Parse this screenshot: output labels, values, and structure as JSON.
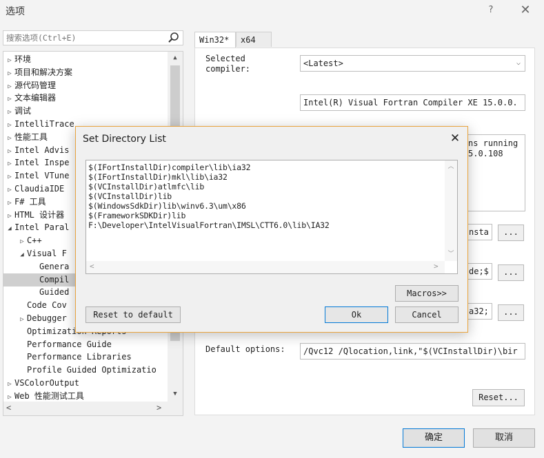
{
  "window": {
    "title": "选项",
    "help": "?",
    "close": "✕"
  },
  "search": {
    "placeholder": "搜索选项(Ctrl+E)"
  },
  "tree": {
    "items": [
      {
        "arrow": "▷",
        "label": "环境",
        "indent": 0
      },
      {
        "arrow": "▷",
        "label": "项目和解决方案",
        "indent": 0
      },
      {
        "arrow": "▷",
        "label": "源代码管理",
        "indent": 0
      },
      {
        "arrow": "▷",
        "label": "文本编辑器",
        "indent": 0
      },
      {
        "arrow": "▷",
        "label": "调试",
        "indent": 0
      },
      {
        "arrow": "▷",
        "label": "IntelliTrace",
        "indent": 0
      },
      {
        "arrow": "▷",
        "label": "性能工具",
        "indent": 0
      },
      {
        "arrow": "▷",
        "label": "Intel Advis",
        "indent": 0
      },
      {
        "arrow": "▷",
        "label": "Intel Inspe",
        "indent": 0
      },
      {
        "arrow": "▷",
        "label": "Intel VTune",
        "indent": 0
      },
      {
        "arrow": "▷",
        "label": "ClaudiaIDE",
        "indent": 0
      },
      {
        "arrow": "▷",
        "label": "F# 工具",
        "indent": 0
      },
      {
        "arrow": "▷",
        "label": "HTML 设计器",
        "indent": 0
      },
      {
        "arrow": "◢",
        "label": "Intel Paral",
        "indent": 0
      },
      {
        "arrow": "▷",
        "label": "C++",
        "indent": 1
      },
      {
        "arrow": "◢",
        "label": "Visual F",
        "indent": 1
      },
      {
        "arrow": "",
        "label": "Genera",
        "indent": 2
      },
      {
        "arrow": "",
        "label": "Compil",
        "indent": 2,
        "selected": true
      },
      {
        "arrow": "",
        "label": "Guided",
        "indent": 2
      },
      {
        "arrow": "",
        "label": "Code Cov",
        "indent": 1
      },
      {
        "arrow": "▷",
        "label": "Debugger",
        "indent": 1
      },
      {
        "arrow": "",
        "label": "Optimization Reports",
        "indent": 1
      },
      {
        "arrow": "",
        "label": "Performance Guide",
        "indent": 1
      },
      {
        "arrow": "",
        "label": "Performance Libraries",
        "indent": 1
      },
      {
        "arrow": "",
        "label": "Profile Guided Optimizatio",
        "indent": 1
      },
      {
        "arrow": "▷",
        "label": "VSColorOutput",
        "indent": 0
      },
      {
        "arrow": "▷",
        "label": "Web 性能测试工具",
        "indent": 0
      }
    ]
  },
  "tabs": [
    {
      "label": "Win32*"
    },
    {
      "label": "x64"
    }
  ],
  "settings": {
    "selected_compiler_label": "Selected\ncompiler:",
    "selected_compiler_value": "<Latest>",
    "compiler_name": "Intel(R) Visual Fortran Compiler XE 15.0.0.",
    "info_text_1": "ns running",
    "info_text_2": "5.0.108",
    "row1_value": "nsta",
    "row2_value": "de;$",
    "row3_value": "a32;",
    "browse_label": "...",
    "default_options_label": "Default options:",
    "default_options_value": "/Qvc12 /Qlocation,link,\"$(VCInstallDir)\\bir",
    "reset_label": "Reset..."
  },
  "dialog": {
    "title": "Set Directory List",
    "close": "✕",
    "directories": [
      "$(IFortInstallDir)compiler\\lib\\ia32",
      "$(IFortInstallDir)mkl\\lib\\ia32",
      "$(VCInstallDir)atlmfc\\lib",
      "$(VCInstallDir)lib",
      "$(WindowsSdkDir)lib\\winv6.3\\um\\x86",
      "$(FrameworkSDKDir)lib",
      "F:\\Developer\\IntelVisualFortran\\IMSL\\CTT6.0\\lib\\IA32"
    ],
    "macros_label": "Macros>>",
    "reset_default_label": "Reset to default",
    "ok_label": "Ok",
    "cancel_label": "Cancel"
  },
  "footer": {
    "ok_label": "确定",
    "cancel_label": "取消"
  }
}
